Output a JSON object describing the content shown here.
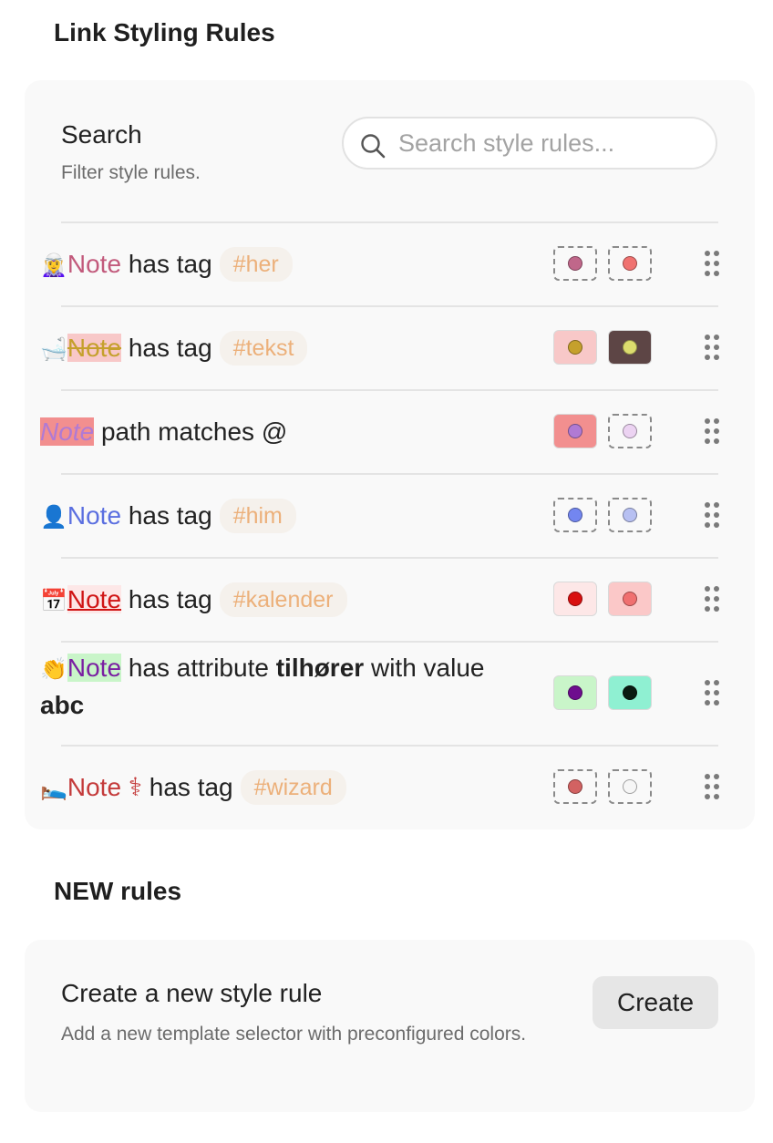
{
  "styling_section": {
    "title": "Link Styling Rules"
  },
  "search": {
    "label": "Search",
    "description": "Filter style rules.",
    "placeholder": "Search style rules...",
    "value": ""
  },
  "rules": [
    {
      "emoji": "🧝‍♀️",
      "note": "Note",
      "note_color": "#c25a7c",
      "condition": "has tag",
      "tag": "#her",
      "swatch1": {
        "style": "dashed",
        "bg": "",
        "dot": "#c0678a"
      },
      "swatch2": {
        "style": "dashed",
        "bg": "",
        "dot": "#f07270"
      }
    },
    {
      "emoji": "🛁",
      "note": "Note",
      "note_color": "#c5a02c",
      "note_bg": "#f8c8c8",
      "strikethrough": true,
      "condition": "has tag",
      "tag": "#tekst",
      "swatch1": {
        "style": "solid",
        "bg": "#f8c8c8",
        "dot": "#c5a02c"
      },
      "swatch2": {
        "style": "solid",
        "bg": "#5d4545",
        "dot": "#dcdc6e"
      }
    },
    {
      "emoji": "",
      "note": "Note",
      "note_color": "#b07ad4",
      "note_bg": "#f28f8f",
      "italic": true,
      "condition": "path matches @",
      "tag": "",
      "swatch1": {
        "style": "solid",
        "bg": "#f28f8f",
        "dot": "#b07ad4"
      },
      "swatch2": {
        "style": "dashed",
        "bg": "",
        "dot": "#ecd3f2"
      }
    },
    {
      "emoji": "👤",
      "note": "Note",
      "note_color": "#5b6fe0",
      "condition": "has tag",
      "tag": "#him",
      "swatch1": {
        "style": "dashed",
        "bg": "",
        "dot": "#7386f0"
      },
      "swatch2": {
        "style": "dashed",
        "bg": "",
        "dot": "#b7c0f2"
      }
    },
    {
      "emoji": "📅",
      "note": "Note",
      "note_color": "#d01515",
      "note_bg": "#fde7e7",
      "underline": true,
      "condition": "has tag",
      "tag": "#kalender",
      "swatch1": {
        "style": "solid",
        "bg": "#fde7e7",
        "dot": "#d90f0f"
      },
      "swatch2": {
        "style": "solid",
        "bg": "#fbc8c8",
        "dot": "#f07070"
      }
    },
    {
      "emoji": "👏",
      "note": "Note",
      "note_color": "#7a1fa2",
      "note_bg": "#c9f5c9",
      "condition": "has attribute",
      "attr": "tilhører",
      "mid": "with value",
      "value": "abc",
      "swatch1": {
        "style": "solid",
        "bg": "#c9f5c9",
        "dot": "#6e0d8e"
      },
      "swatch2": {
        "style": "solid",
        "bg": "#8ff0d2",
        "dot": "#0a1a12"
      }
    },
    {
      "emoji": "🛌",
      "note": "Note",
      "note_color": "#c43b3b",
      "suffix": "⚕",
      "condition": "has tag",
      "tag": "#wizard",
      "swatch1": {
        "style": "dashed",
        "bg": "",
        "dot": "#d26262"
      },
      "swatch2": {
        "style": "dashed",
        "bg": "",
        "dot": "#f6f6f6"
      }
    }
  ],
  "new_section": {
    "title": "NEW rules"
  },
  "create": {
    "title": "Create a new style rule",
    "description": "Add a new template selector with preconfigured colors.",
    "button_label": "Create"
  }
}
